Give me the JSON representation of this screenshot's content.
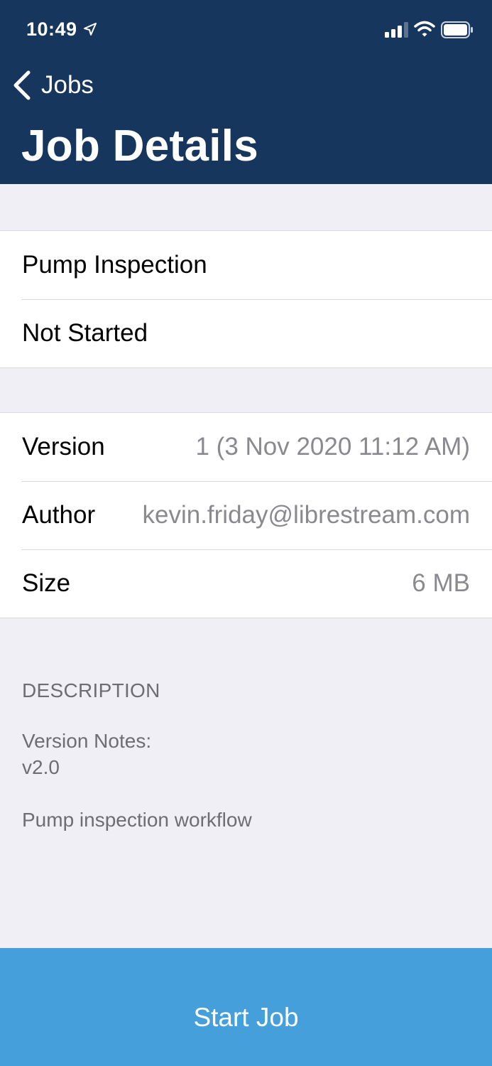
{
  "status_bar": {
    "time": "10:49",
    "icons": [
      "location-arrow-icon",
      "cellular-signal-icon",
      "wifi-icon",
      "battery-icon"
    ]
  },
  "nav": {
    "back_label": "Jobs",
    "title": "Job Details"
  },
  "job": {
    "name": "Pump Inspection",
    "status": "Not Started"
  },
  "details": [
    {
      "label": "Version",
      "value": "1 (3 Nov 2020 11:12 AM)"
    },
    {
      "label": "Author",
      "value": "kevin.friday@librestream.com"
    },
    {
      "label": "Size",
      "value": "6 MB"
    }
  ],
  "description": {
    "header": "DESCRIPTION",
    "body": "Version Notes:\nv2.0\n\nPump inspection workflow"
  },
  "action": {
    "start_label": "Start Job"
  },
  "colors": {
    "header_bg": "#17365d",
    "button_bg": "#459fdb",
    "page_bg": "#f0eff5",
    "secondary_text": "#8a8a8e"
  }
}
